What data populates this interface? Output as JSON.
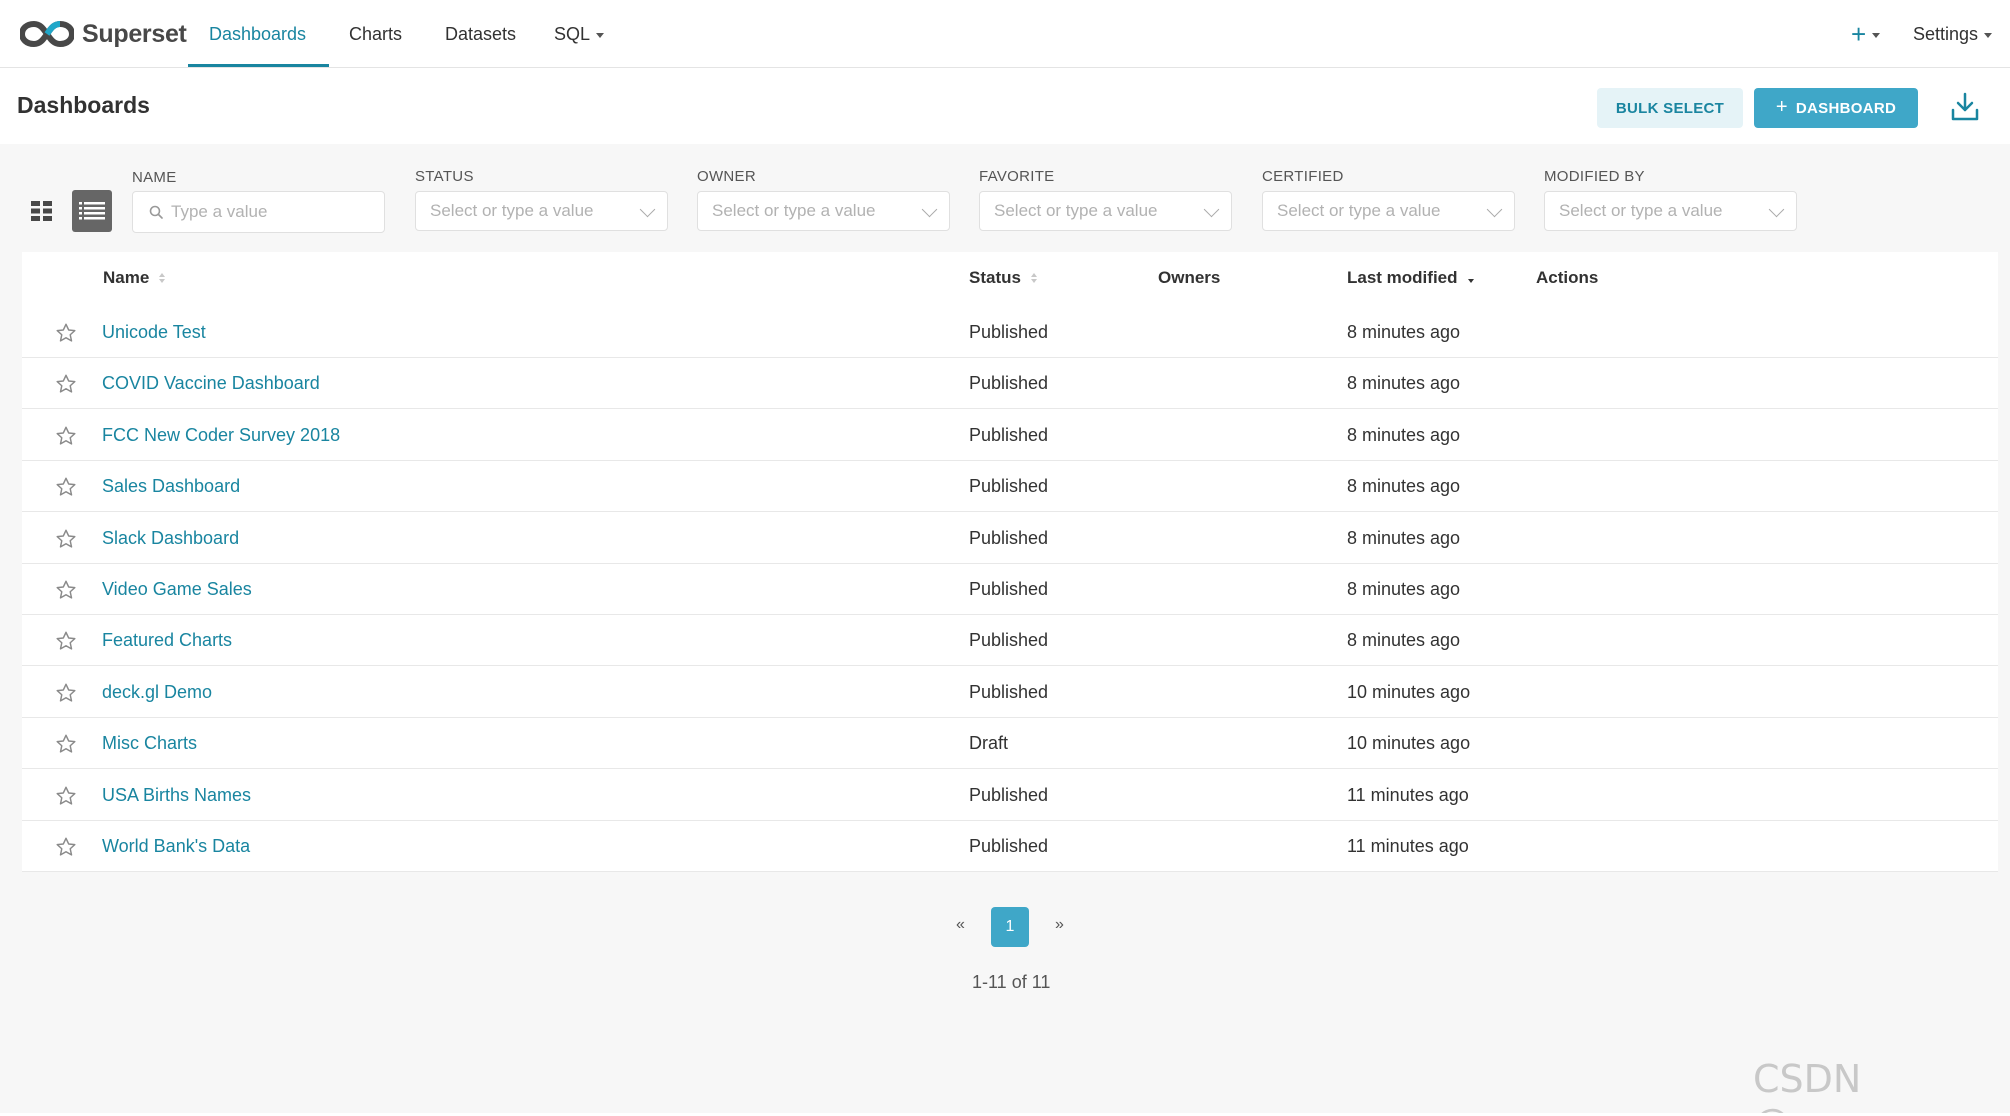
{
  "brand": {
    "name": "Superset",
    "accent": "#1985a0",
    "primary_button": "#3fa7c8"
  },
  "nav": {
    "items": [
      {
        "label": "Dashboards",
        "active": true
      },
      {
        "label": "Charts",
        "active": false
      },
      {
        "label": "Datasets",
        "active": false
      },
      {
        "label": "SQL",
        "active": false
      }
    ],
    "plus_label": "+",
    "settings_label": "Settings"
  },
  "header": {
    "title": "Dashboards",
    "bulk_select_label": "BULK SELECT",
    "add_dashboard_label": "DASHBOARD"
  },
  "filters": [
    {
      "label": "NAME",
      "placeholder": "Type a value"
    },
    {
      "label": "STATUS",
      "placeholder": "Select or type a value"
    },
    {
      "label": "OWNER",
      "placeholder": "Select or type a value"
    },
    {
      "label": "FAVORITE",
      "placeholder": "Select or type a value"
    },
    {
      "label": "CERTIFIED",
      "placeholder": "Select or type a value"
    },
    {
      "label": "MODIFIED BY",
      "placeholder": "Select or type a value"
    }
  ],
  "table": {
    "columns": [
      "Name",
      "Status",
      "Owners",
      "Last modified",
      "Actions"
    ],
    "rows": [
      {
        "name": "Unicode Test",
        "status": "Published",
        "modified": "8 minutes ago"
      },
      {
        "name": "COVID Vaccine Dashboard",
        "status": "Published",
        "modified": "8 minutes ago"
      },
      {
        "name": "FCC New Coder Survey 2018",
        "status": "Published",
        "modified": "8 minutes ago"
      },
      {
        "name": "Sales Dashboard",
        "status": "Published",
        "modified": "8 minutes ago"
      },
      {
        "name": "Slack Dashboard",
        "status": "Published",
        "modified": "8 minutes ago"
      },
      {
        "name": "Video Game Sales",
        "status": "Published",
        "modified": "8 minutes ago"
      },
      {
        "name": "Featured Charts",
        "status": "Published",
        "modified": "8 minutes ago"
      },
      {
        "name": "deck.gl Demo",
        "status": "Published",
        "modified": "10 minutes ago"
      },
      {
        "name": "Misc Charts",
        "status": "Draft",
        "modified": "10 minutes ago"
      },
      {
        "name": "USA Births Names",
        "status": "Published",
        "modified": "11 minutes ago"
      },
      {
        "name": "World Bank's Data",
        "status": "Published",
        "modified": "11 minutes ago"
      }
    ]
  },
  "pagination": {
    "prev": "«",
    "current": "1",
    "next": "»",
    "info": "1-11 of 11"
  },
  "watermark": "CSDN @c_zyer"
}
